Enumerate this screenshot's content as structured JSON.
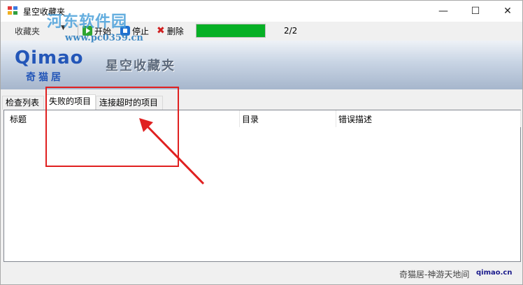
{
  "window": {
    "title": "星空收藏夹",
    "controls": {
      "minimize": "—",
      "maximize": "☐",
      "close": "✕"
    }
  },
  "watermark": {
    "text": "河东软件园",
    "url": "www.pc0359.cn"
  },
  "toolbar": {
    "dropdown_label": "收藏夹",
    "start_label": "开始",
    "stop_label": "停止",
    "delete_label": "删除",
    "progress_fraction": 1.0,
    "counter": "2/2"
  },
  "banner": {
    "logo_text": "Qimao",
    "logo_sub": "奇猫居",
    "title": "星空收藏夹"
  },
  "tabs": [
    {
      "label": "检查列表",
      "active": false
    },
    {
      "label": "失败的项目",
      "active": true
    },
    {
      "label": "连接超时的项目",
      "active": false
    }
  ],
  "table": {
    "columns": [
      "标题",
      "目录",
      "错误描述"
    ],
    "rows": []
  },
  "status": {
    "text": "奇猫居-神游天地间",
    "domain": "qimao.cn"
  },
  "colors": {
    "progress": "#06b025",
    "annotation": "#e02020",
    "brand": "#2356b8"
  },
  "icons": [
    "app-icon",
    "start-icon",
    "stop-icon",
    "delete-icon"
  ]
}
